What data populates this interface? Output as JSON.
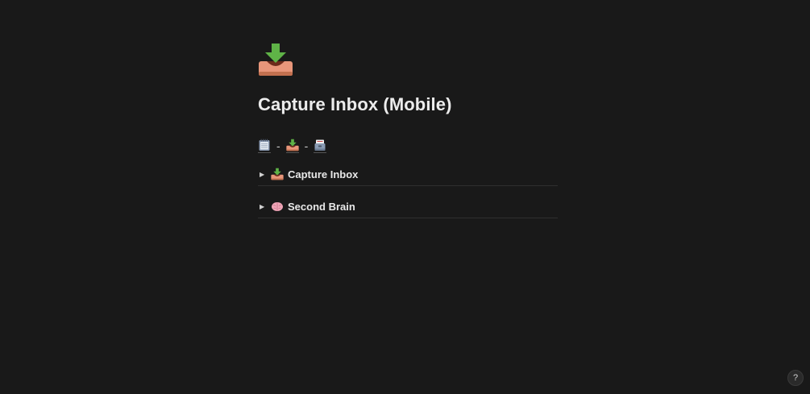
{
  "page": {
    "icon": "inbox-tray-icon",
    "title": "Capture Inbox (Mobile)"
  },
  "quick_links": {
    "items": [
      {
        "icon": "spiral-notepad-icon"
      },
      {
        "icon": "inbox-tray-icon"
      },
      {
        "icon": "card-file-box-icon"
      }
    ],
    "separator": "-"
  },
  "toggles": [
    {
      "icon": "inbox-tray-icon",
      "label": "Capture Inbox"
    },
    {
      "icon": "brain-icon",
      "label": "Second Brain"
    }
  ],
  "help": {
    "label": "?"
  },
  "colors": {
    "background": "#191919",
    "text": "#e6e6e6",
    "divider": "#2f2f2f"
  }
}
